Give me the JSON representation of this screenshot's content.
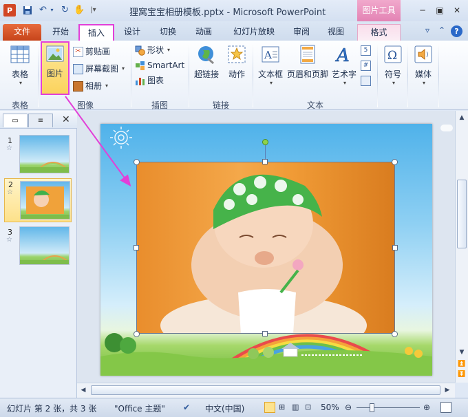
{
  "titlebar": {
    "app_icon": "P",
    "title": "狸窝宝宝相册模板.pptx - Microsoft PowerPoint",
    "contextual_tool": "图片工具",
    "quick_access": [
      "save-icon",
      "undo-icon",
      "redo-icon",
      "format-painter-icon"
    ]
  },
  "tabs": {
    "file": "文件",
    "home": "开始",
    "insert": "插入",
    "design": "设计",
    "transitions": "切换",
    "animations": "动画",
    "slideshow": "幻灯片放映",
    "review": "审阅",
    "view": "视图",
    "format": "格式"
  },
  "ribbon": {
    "groups": {
      "tables": "表格",
      "images": "图像",
      "illustrations": "插图",
      "links": "链接",
      "text": "文本"
    },
    "table": "表格",
    "picture": "图片",
    "clipart": "剪贴画",
    "screenshot": "屏幕截图",
    "album": "相册",
    "shapes": "形状",
    "smartart": "SmartArt",
    "chart": "图表",
    "hyperlink": "超链接",
    "action": "动作",
    "textbox": "文本框",
    "header_footer": "页眉和页脚",
    "wordart": "艺术字",
    "symbol": "符号",
    "media": "媒体",
    "symbol_glyph": "Ω"
  },
  "slides": [
    {
      "num": "1",
      "star": "☆"
    },
    {
      "num": "2",
      "star": "☆"
    },
    {
      "num": "3",
      "star": "☆"
    }
  ],
  "status": {
    "slide_info": "幻灯片 第 2 张，共 3 张",
    "theme": "\"Office 主题\"",
    "language": "中文(中国)",
    "zoom": "50%"
  },
  "colors": {
    "accent_highlight": "#e23fd8",
    "file_tab": "#d24726",
    "picture_tools": "#e383b4"
  }
}
